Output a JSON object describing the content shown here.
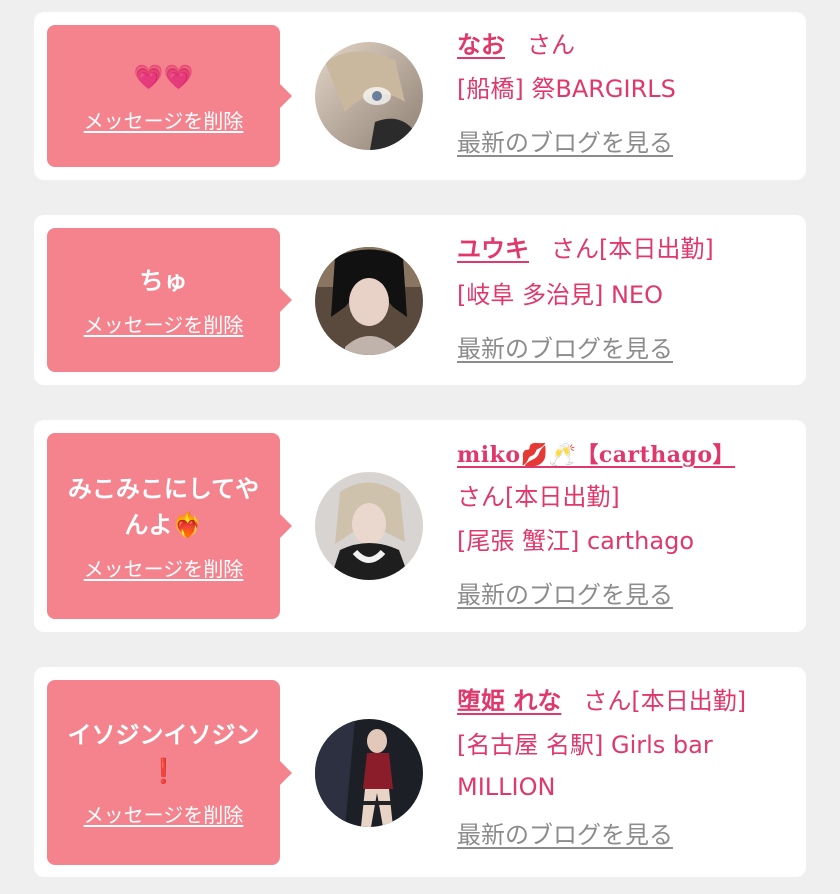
{
  "delete_label": "メッセージを削除",
  "san_label": "さん",
  "blog_label": "最新のブログを見る",
  "cards": [
    {
      "message": "💗💗",
      "name": "なお",
      "status": "",
      "shop_line1": "[船橋] 祭BARGIRLS",
      "shop_line2": ""
    },
    {
      "message": "ちゅ",
      "name": "ユウキ",
      "status": "[本日出勤]",
      "shop_line1": "[岐阜 多治見] NEO",
      "shop_line2": ""
    },
    {
      "message": "みこみこにしてやんよ❤️‍🔥",
      "name": "miko💋🥂【carthago】",
      "status": "[本日出勤]",
      "shop_line1": "[尾張 蟹江] carthago",
      "shop_line2": ""
    },
    {
      "message": "イソジンイソジン❗",
      "name": "堕姫 れな",
      "status": "[本日出勤]",
      "shop_line1": "[名古屋 名駅] Girls bar",
      "shop_line2": "MILLION"
    }
  ],
  "colors": {
    "page_bg": "#efeff0",
    "bubble": "#f4838e",
    "accent": "#e0386b",
    "link_gray": "#8c8c8c"
  }
}
